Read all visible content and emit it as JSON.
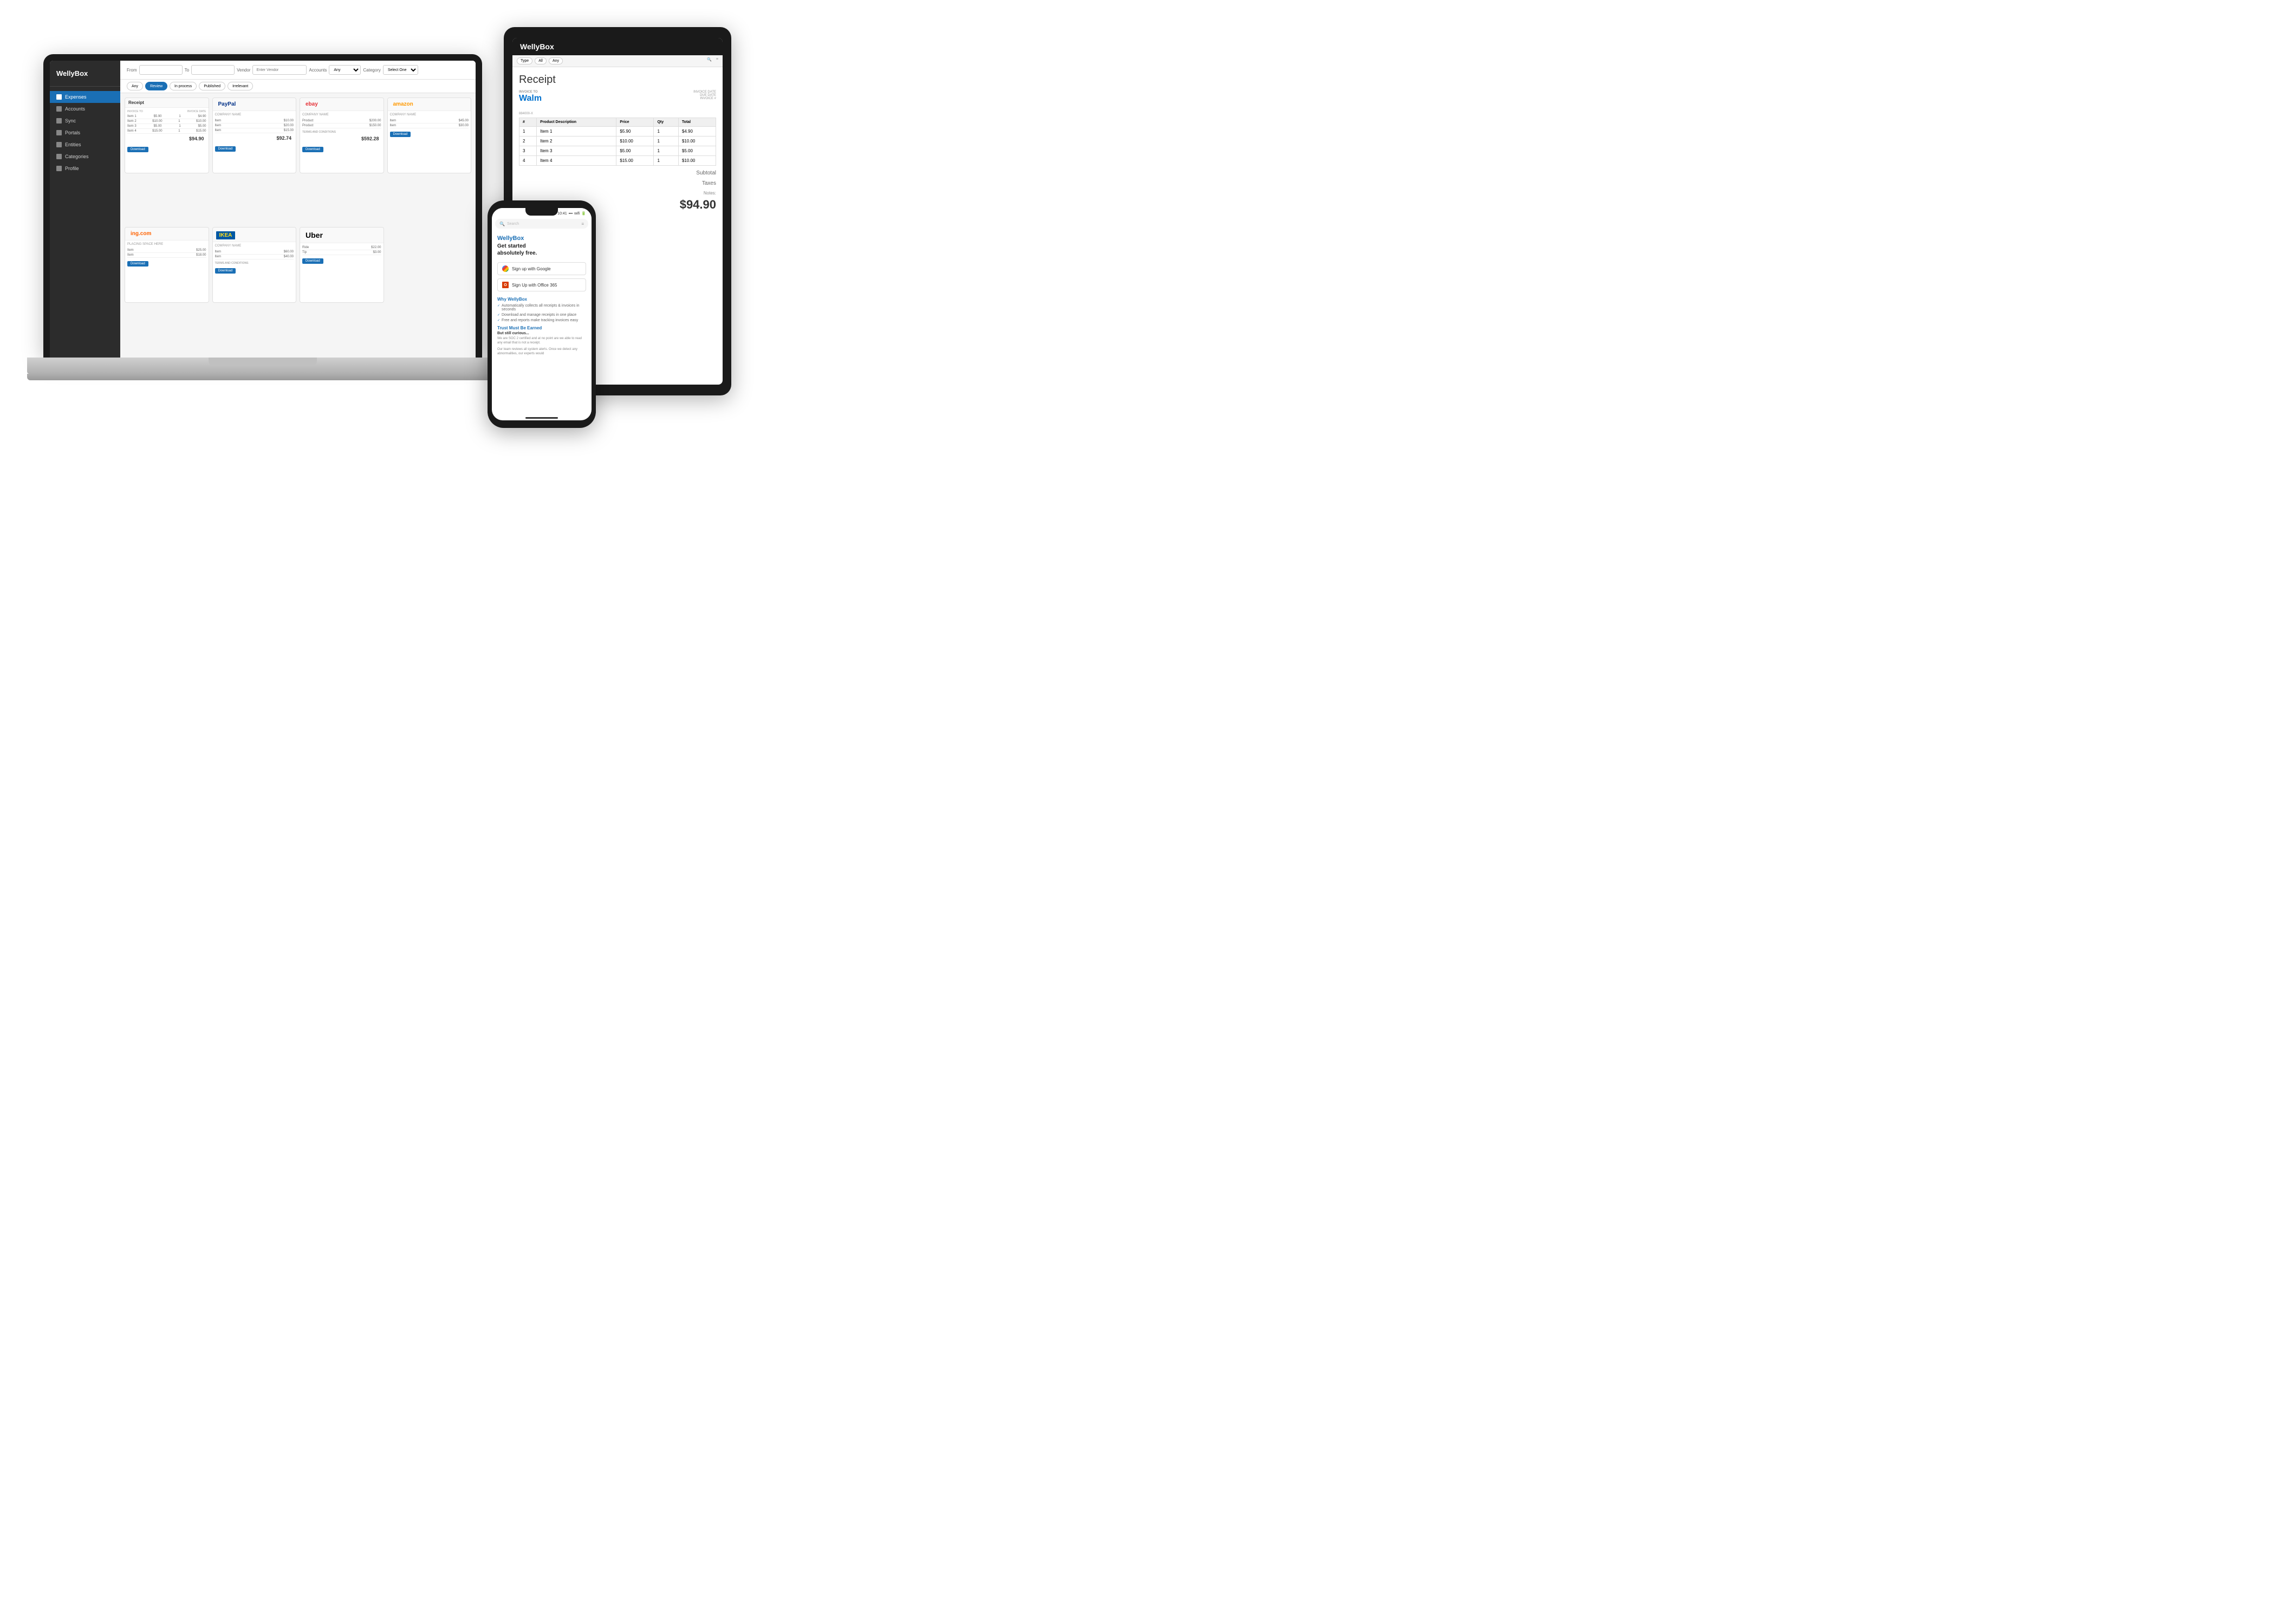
{
  "laptop": {
    "logo": "WellyBox",
    "sidebar": {
      "items": [
        {
          "label": "Expenses",
          "active": true,
          "icon": "expenses-icon"
        },
        {
          "label": "Accounts",
          "active": false,
          "icon": "accounts-icon"
        },
        {
          "label": "Sync",
          "active": false,
          "icon": "sync-icon"
        },
        {
          "label": "Portals",
          "active": false,
          "icon": "portals-icon"
        },
        {
          "label": "Entities",
          "active": false,
          "icon": "entities-icon"
        },
        {
          "label": "Categories",
          "active": false,
          "icon": "categories-icon"
        },
        {
          "label": "Profile",
          "active": false,
          "icon": "profile-icon"
        }
      ]
    },
    "toolbar": {
      "from_label": "From",
      "to_label": "To",
      "vendor_label": "Vendor",
      "vendor_placeholder": "Enter Vendor",
      "accounts_label": "Accounts",
      "category_label": "Category",
      "select_one": "Select One"
    },
    "filters": {
      "options": [
        "Any",
        "Review",
        "In process",
        "Published",
        "Irrelevant"
      ],
      "active": "Review"
    },
    "receipts": [
      {
        "vendor": "Receipt",
        "type": "wellybox",
        "items": [
          {
            "desc": "Item 1",
            "price": "$5.90",
            "qty": 1,
            "total": "$4.90"
          },
          {
            "desc": "Item 2",
            "price": "$10.00",
            "qty": 1,
            "total": "$10.00"
          },
          {
            "desc": "Item 3",
            "price": "$5.00",
            "qty": 1,
            "total": "$5.00"
          },
          {
            "desc": "Item 4",
            "price": "$15.00",
            "qty": 1,
            "total": "$15.00"
          }
        ],
        "total": "$94.90",
        "btn": "Download"
      },
      {
        "vendor": "PayPal",
        "type": "paypal",
        "total": "$92.74",
        "btn": "Download"
      },
      {
        "vendor": "ebay",
        "type": "ebay",
        "total": "$592.28",
        "btn": "Download"
      },
      {
        "vendor": "amazon",
        "type": "amazon",
        "btn": "Download"
      },
      {
        "vendor": "ing.com",
        "type": "ing",
        "btn": "Download"
      },
      {
        "vendor": "IKEA",
        "type": "ikea",
        "btn": "Download"
      },
      {
        "vendor": "Uber",
        "type": "uber",
        "btn": "Download"
      }
    ]
  },
  "tablet": {
    "logo": "WellyBox",
    "receipt_title": "Receipt",
    "invoice_to_label": "INVOICE TO",
    "invoice_date_label": "INVOICE DATE",
    "due_date_label": "DUE DATE",
    "invoice_num_label": "INVOICE #",
    "walmart_logo": "Walm",
    "table": {
      "headers": [
        "#",
        "Product Description",
        "Price",
        "Qty",
        "Total"
      ],
      "rows": [
        [
          "1",
          "Item 1",
          "$5.90",
          "1",
          "$4.90"
        ],
        [
          "2",
          "Item 2",
          "$10.00",
          "1",
          "$10.00"
        ],
        [
          "3",
          "Item 3",
          "$5.00",
          "1",
          "$5.00"
        ],
        [
          "4",
          "Item 4",
          "$15.00",
          "1",
          "$10.00"
        ]
      ]
    },
    "subtotal_label": "Subtotal",
    "taxes_label": "Taxes",
    "notes_label": "Notes:",
    "grand_total": "$94.90",
    "filters": [
      "Type",
      "All",
      "Any"
    ]
  },
  "phone": {
    "wellybox_title": "WellyBox",
    "headline_line1": "Get started",
    "headline_line2": "absolutely free.",
    "google_btn": "Sign up with Google",
    "office_btn": "Sign Up with Office 365",
    "why_title": "Why WellyBox",
    "why_items": [
      "Automatically collects all receipts & invoices in seconds",
      "Download and manage receipts in one place",
      "Free and reports make tracking invoices easy, save money"
    ],
    "trust_title": "Trust Must Be Earned",
    "trust_sub": "But still curious...",
    "trust_text1": "We are SOC 2 certified and at no point are we able to read any email that is not a receipt.",
    "trust_text2": "Our team reviews all system alerts. Once we detect any abnormalities, our experts would"
  }
}
